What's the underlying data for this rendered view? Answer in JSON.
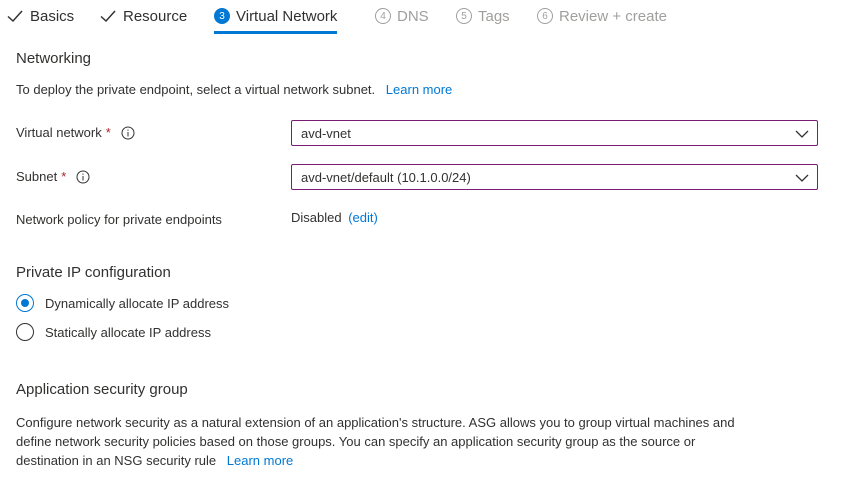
{
  "tabs": [
    {
      "label": "Basics",
      "state": "done"
    },
    {
      "label": "Resource",
      "state": "done"
    },
    {
      "number": "3",
      "label": "Virtual Network",
      "state": "active"
    },
    {
      "number": "4",
      "label": "DNS",
      "state": "disabled"
    },
    {
      "number": "5",
      "label": "Tags",
      "state": "disabled"
    },
    {
      "number": "6",
      "label": "Review + create",
      "state": "disabled"
    }
  ],
  "networking": {
    "heading": "Networking",
    "description": "To deploy the private endpoint, select a virtual network subnet.",
    "learn_more": "Learn more",
    "virtual_network": {
      "label": "Virtual network",
      "required": "*",
      "value": "avd-vnet"
    },
    "subnet": {
      "label": "Subnet",
      "required": "*",
      "value": "avd-vnet/default (10.1.0.0/24)"
    },
    "policy": {
      "label": "Network policy for private endpoints",
      "value": "Disabled",
      "edit": "(edit)"
    }
  },
  "private_ip": {
    "heading": "Private IP configuration",
    "options": [
      {
        "label": "Dynamically allocate IP address",
        "checked": true
      },
      {
        "label": "Statically allocate IP address",
        "checked": false
      }
    ]
  },
  "asg": {
    "heading": "Application security group",
    "line1": "Configure network security as a natural extension of an application's structure. ASG allows you to group virtual machines and",
    "line2": "define network security policies based on those groups. You can specify an application security group as the source or",
    "line3": "destination in an NSG security rule",
    "learn_more": "Learn more"
  },
  "colors": {
    "accent": "#0078d4",
    "dropdown_border": "#7c1b73",
    "required": "#a4262c",
    "disabled": "#a19f9d"
  }
}
